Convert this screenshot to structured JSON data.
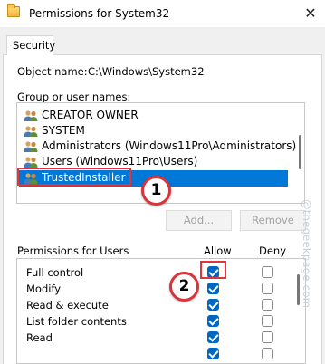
{
  "window": {
    "title": "Permissions for System32",
    "close_glyph": "✕"
  },
  "tabs": [
    {
      "label": "Security"
    }
  ],
  "object": {
    "label": "Object name:",
    "value": "C:\\Windows\\System32"
  },
  "groups": {
    "label": "Group or user names:",
    "items": [
      {
        "label": "CREATOR OWNER",
        "icon": "users-icon"
      },
      {
        "label": "SYSTEM",
        "icon": "users-icon"
      },
      {
        "label": "Administrators (Windows11Pro\\Administrators)",
        "icon": "users-icon"
      },
      {
        "label": "Users (Windows11Pro\\Users)",
        "icon": "users-icon"
      },
      {
        "label": "TrustedInstaller",
        "icon": "users-icon",
        "selected": true
      }
    ]
  },
  "buttons": {
    "add": "Add...",
    "remove": "Remove"
  },
  "permissions": {
    "label": "Permissions for Users",
    "allow_header": "Allow",
    "deny_header": "Deny",
    "rows": [
      {
        "label": "Full control",
        "allow": true,
        "deny": false
      },
      {
        "label": "Modify",
        "allow": true,
        "deny": false
      },
      {
        "label": "Read & execute",
        "allow": true,
        "deny": false
      },
      {
        "label": "List folder contents",
        "allow": true,
        "deny": false
      },
      {
        "label": "Read",
        "allow": true,
        "deny": false
      },
      {
        "label": "",
        "allow": true,
        "deny": false
      }
    ]
  },
  "callouts": [
    {
      "number": "1"
    },
    {
      "number": "2"
    }
  ],
  "watermark": "@thegeekpage.com",
  "colors": {
    "selection": "#0078d7",
    "checkbox": "#0067c0",
    "callout": "#d8343a"
  }
}
